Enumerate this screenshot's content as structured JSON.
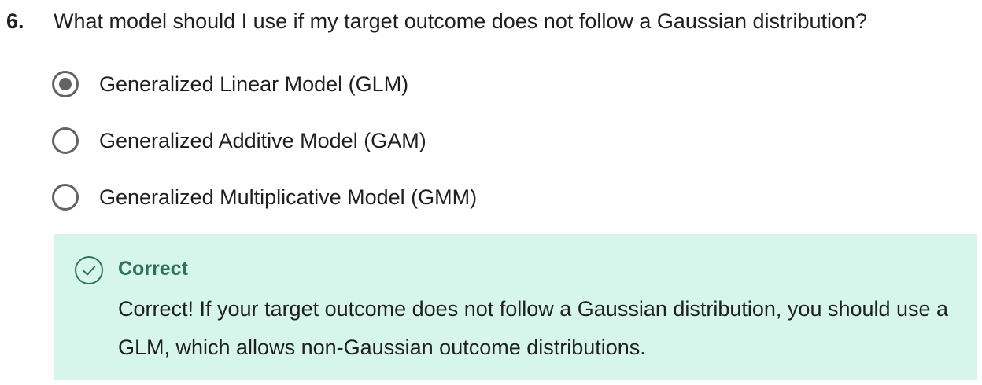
{
  "question": {
    "number": "6.",
    "text": "What model should I use if my target outcome does not follow a Gaussian distribution?"
  },
  "options": [
    {
      "label": "Generalized Linear Model (GLM)",
      "selected": true
    },
    {
      "label": "Generalized Additive Model (GAM)",
      "selected": false
    },
    {
      "label": "Generalized Multiplicative Model (GMM)",
      "selected": false
    }
  ],
  "feedback": {
    "icon": "check-circle-icon",
    "title": "Correct",
    "body": "Correct! If your target outcome does not follow a Gaussian distribution, you should use a GLM, which allows non-Gaussian outcome distributions.",
    "background_color": "#d6f6ec",
    "accent_color": "#2e7258"
  }
}
